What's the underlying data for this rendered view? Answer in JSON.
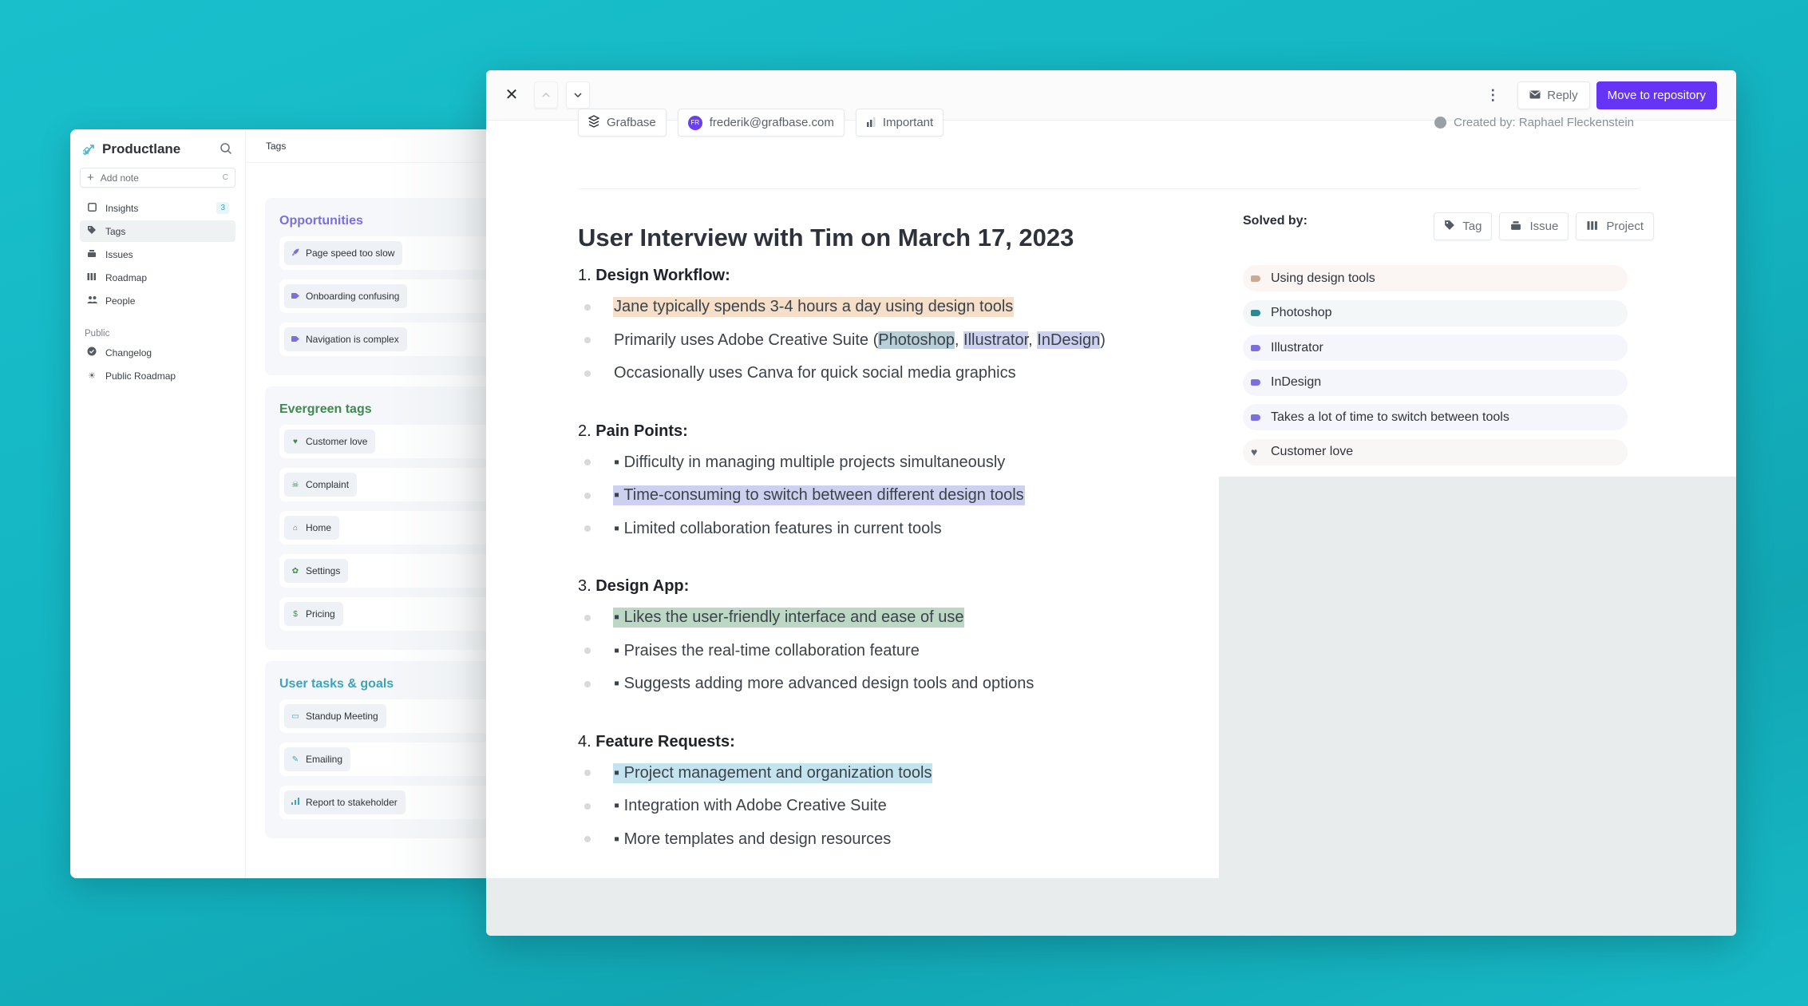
{
  "left_window": {
    "brand": "Productlane",
    "add_note": {
      "label": "Add note",
      "shortcut": "C"
    },
    "nav": [
      {
        "label": "Insights",
        "icon": "inbox-icon",
        "badge": "3"
      },
      {
        "label": "Tags",
        "icon": "tag-icon",
        "active": true
      },
      {
        "label": "Issues",
        "icon": "stack-icon"
      },
      {
        "label": "Roadmap",
        "icon": "roadmap-icon"
      },
      {
        "label": "People",
        "icon": "people-icon"
      }
    ],
    "public_section": "Public",
    "public_nav": [
      {
        "label": "Changelog",
        "icon": "check-circle-icon"
      },
      {
        "label": "Public Roadmap",
        "icon": "sun-icon"
      }
    ],
    "tags_header": "Tags",
    "tag_groups": [
      {
        "title": "Opportunities",
        "color": "#7b6fe0",
        "tags": [
          {
            "label": "Page speed too slow",
            "icon": "rocket-icon"
          },
          {
            "label": "Onboarding confusing",
            "icon": "tag-icon"
          },
          {
            "label": "Navigation is complex",
            "icon": "tag-icon"
          }
        ]
      },
      {
        "title": "Evergreen tags",
        "color": "#3f8a4f",
        "tags": [
          {
            "label": "Customer love",
            "icon": "heart-icon"
          },
          {
            "label": "Complaint",
            "icon": "skull-icon"
          },
          {
            "label": "Home",
            "icon": "home-icon"
          },
          {
            "label": "Settings",
            "icon": "gear-icon"
          },
          {
            "label": "Pricing",
            "icon": "dollar-icon"
          }
        ]
      },
      {
        "title": "User tasks & goals",
        "color": "#3fa3b8",
        "tags": [
          {
            "label": "Standup Meeting",
            "icon": "calendar-icon"
          },
          {
            "label": "Emailing",
            "icon": "feather-icon"
          },
          {
            "label": "Report to stakeholder",
            "icon": "bar-chart-icon"
          }
        ]
      }
    ]
  },
  "right_window": {
    "header": {
      "close": "✕",
      "up": "⌃",
      "down": "⌄",
      "more": "⋮",
      "reply_label": "Reply",
      "move_label": "Move to repository"
    },
    "meta": {
      "company": "Grafbase",
      "email": "frederik@grafbase.com",
      "avatar_initials": "FR",
      "priority": "Important",
      "created_by": "Created by: Raphael Fleckenstein"
    },
    "doc": {
      "title": "User Interview with Tim on March 17, 2023",
      "sections": [
        {
          "num": "1.",
          "title": "Design Workflow:",
          "items": [
            {
              "text": "Jane typically spends 3-4 hours a day using design tools",
              "hl": "orange"
            },
            {
              "parts": [
                "Primarily uses Adobe Creative Suite (",
                "Photoshop",
                ", ",
                "Illustrator",
                ", ",
                "InDesign",
                ")"
              ]
            },
            {
              "text": "Occasionally uses Canva for quick social media graphics"
            }
          ]
        },
        {
          "num": "2.",
          "title": "Pain Points:",
          "items": [
            {
              "text": "▪ Difficulty in managing multiple projects simultaneously"
            },
            {
              "text": "▪ Time-consuming to switch between different design tools",
              "hl": "lav"
            },
            {
              "text": "▪ Limited collaboration features in current tools"
            }
          ]
        },
        {
          "num": "3.",
          "title": "Design App:",
          "items": [
            {
              "text": "▪ Likes the user-friendly interface and ease of use",
              "hl": "green"
            },
            {
              "text": "▪ Praises the real-time collaboration feature"
            },
            {
              "text": "▪ Suggests adding more advanced design tools and options"
            }
          ]
        },
        {
          "num": "4.",
          "title": "Feature Requests:",
          "items": [
            {
              "text": "▪ Project management and organization tools",
              "hl": "blue"
            },
            {
              "text": "▪ Integration with Adobe Creative Suite"
            },
            {
              "text": "▪ More templates and design resources"
            }
          ]
        }
      ]
    },
    "solved_by": {
      "label": "Solved by:",
      "actions": [
        "Tag",
        "Issue",
        "Project"
      ],
      "items": [
        {
          "label": "Using design tools",
          "dot": "#c9ab93",
          "bg": "#fbf6f4"
        },
        {
          "label": "Photoshop",
          "dot": "#2a8a93",
          "bg": "#f3f7f8"
        },
        {
          "label": "Illustrator",
          "dot": "#7b6fe0",
          "bg": "#f5f6fb"
        },
        {
          "label": "InDesign",
          "dot": "#7b6fe0",
          "bg": "#f5f6fb"
        },
        {
          "label": "Takes a lot of time to switch between tools",
          "dot": "#7b6fe0",
          "bg": "#f5f6fb"
        },
        {
          "label": "Customer love",
          "heart": true,
          "bg": "#f9f6f6"
        }
      ]
    }
  },
  "colors": {
    "accent": "#6534f5",
    "background": "#16b8c6"
  }
}
